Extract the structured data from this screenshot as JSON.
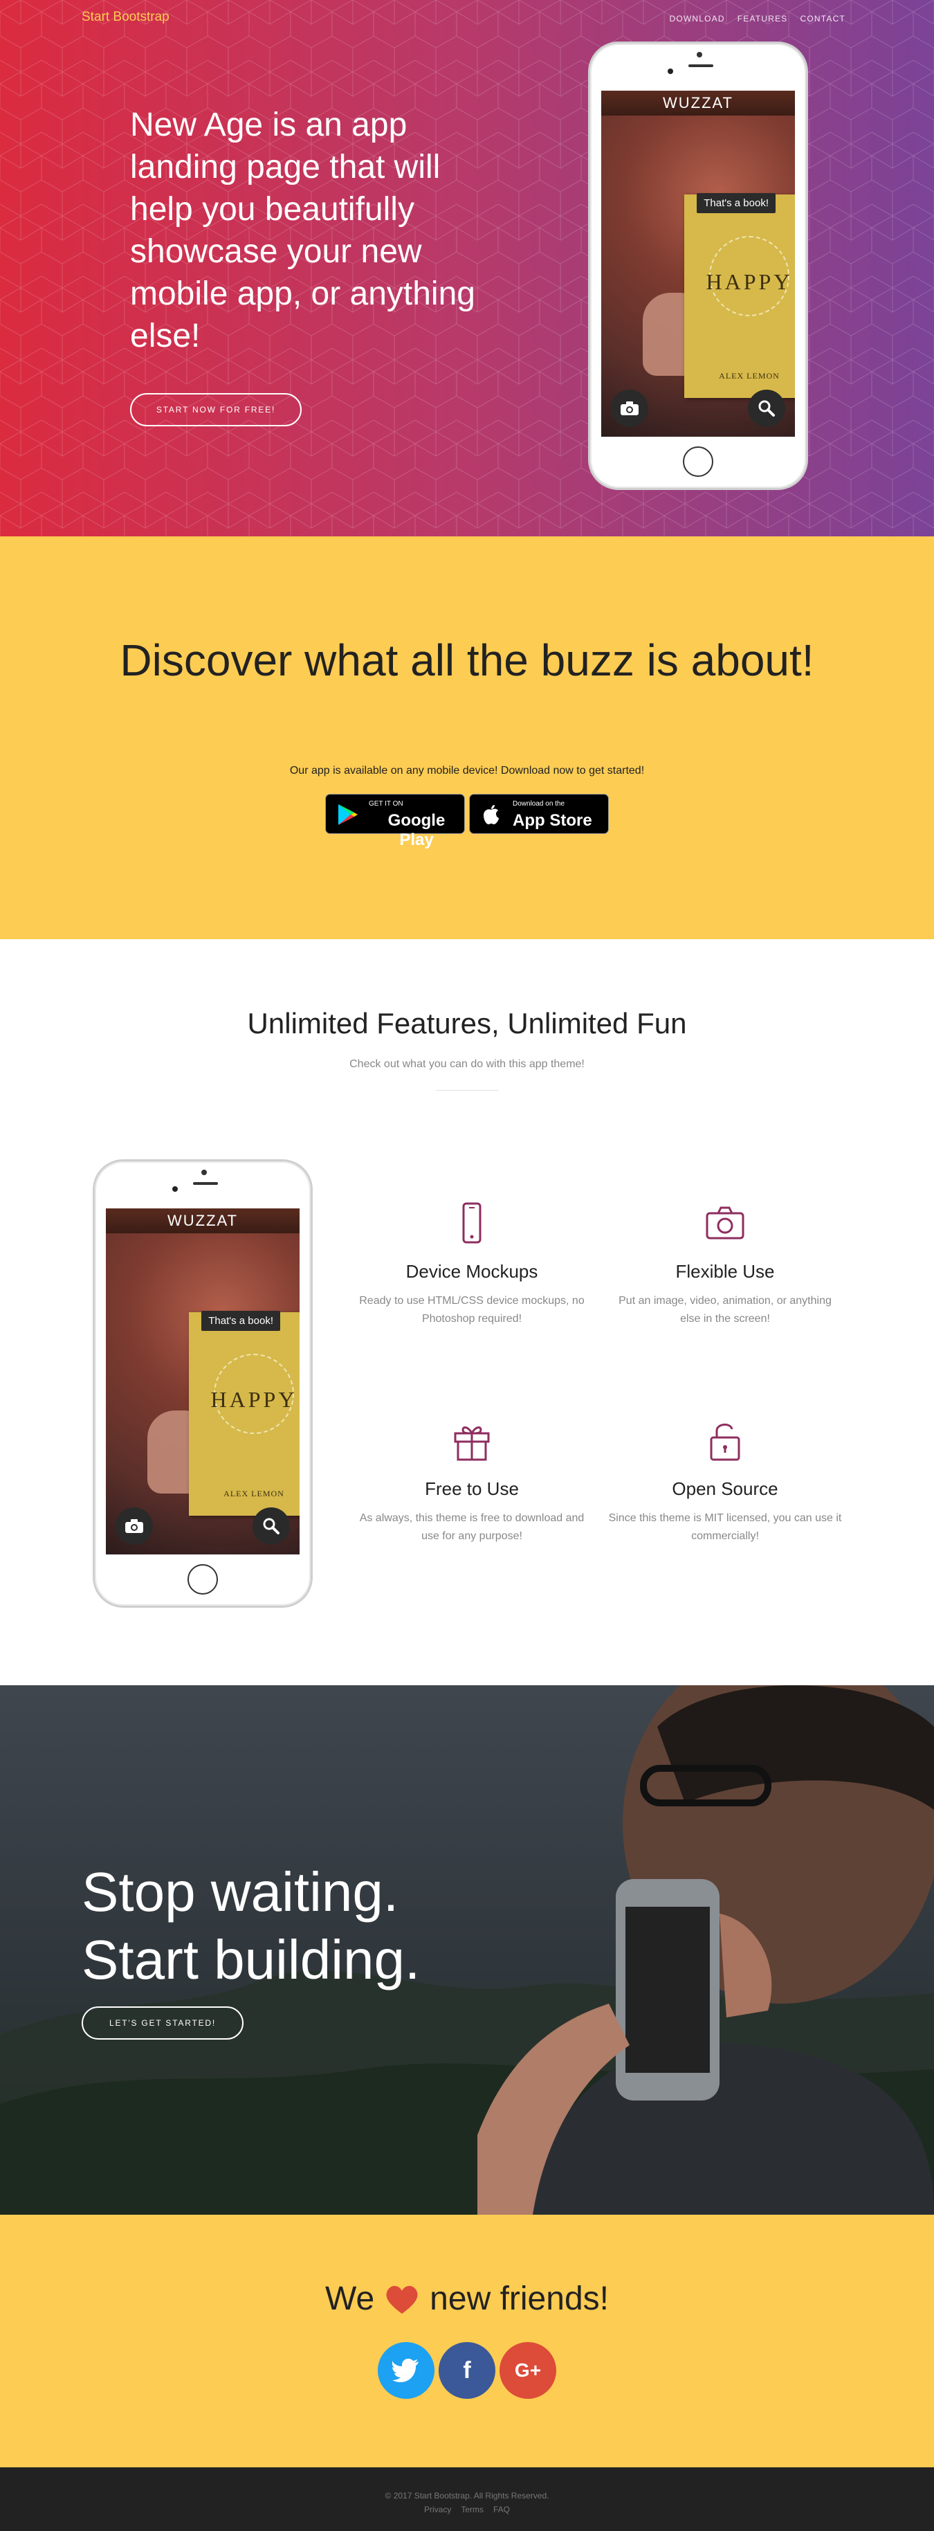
{
  "nav": {
    "brand": "Start Bootstrap",
    "items": [
      "Download",
      "Features",
      "Contact"
    ]
  },
  "hero": {
    "headline": "New Age is an app landing page that will help you beautifully showcase your new mobile app, or anything else!",
    "cta": "Start Now for Free!"
  },
  "phone": {
    "app_title": "WUZZAT",
    "bubble": "That's a book!",
    "book_title": "HAPPY",
    "book_author": "ALEX LEMON",
    "left_icon": "camera-icon",
    "right_icon": "search-icon"
  },
  "download": {
    "heading": "Discover what all the buzz is about!",
    "subtext": "Our app is available on any mobile device! Download now to get started!",
    "google": {
      "small": "GET IT ON",
      "big": "Google Play"
    },
    "apple": {
      "small": "Download on the",
      "big": "App Store"
    }
  },
  "features": {
    "heading": "Unlimited Features, Unlimited Fun",
    "subtext": "Check out what you can do with this app theme!",
    "items": [
      {
        "icon": "phone-icon",
        "title": "Device Mockups",
        "desc": "Ready to use HTML/CSS device mockups, no Photoshop required!"
      },
      {
        "icon": "camera-icon",
        "title": "Flexible Use",
        "desc": "Put an image, video, animation, or anything else in the screen!"
      },
      {
        "icon": "gift-icon",
        "title": "Free to Use",
        "desc": "As always, this theme is free to download and use for any purpose!"
      },
      {
        "icon": "lock-open-icon",
        "title": "Open Source",
        "desc": "Since this theme is MIT licensed, you can use it commercially!"
      }
    ]
  },
  "cta": {
    "line1": "Stop waiting.",
    "line2": "Start building.",
    "button": "Let's Get Started!"
  },
  "contact": {
    "pre": "We",
    "post": "new friends!",
    "social": [
      {
        "name": "twitter",
        "glyph": "t"
      },
      {
        "name": "facebook",
        "glyph": "f"
      },
      {
        "name": "google-plus",
        "glyph": "G+"
      }
    ]
  },
  "footer": {
    "copyright": "© 2017 Start Bootstrap. All Rights Reserved.",
    "links": [
      "Privacy",
      "Terms",
      "FAQ"
    ]
  },
  "colors": {
    "accent": "#fdcc52",
    "hero_start": "#db2b3f",
    "hero_end": "#7b4397",
    "icon": "#8e2e5f"
  }
}
